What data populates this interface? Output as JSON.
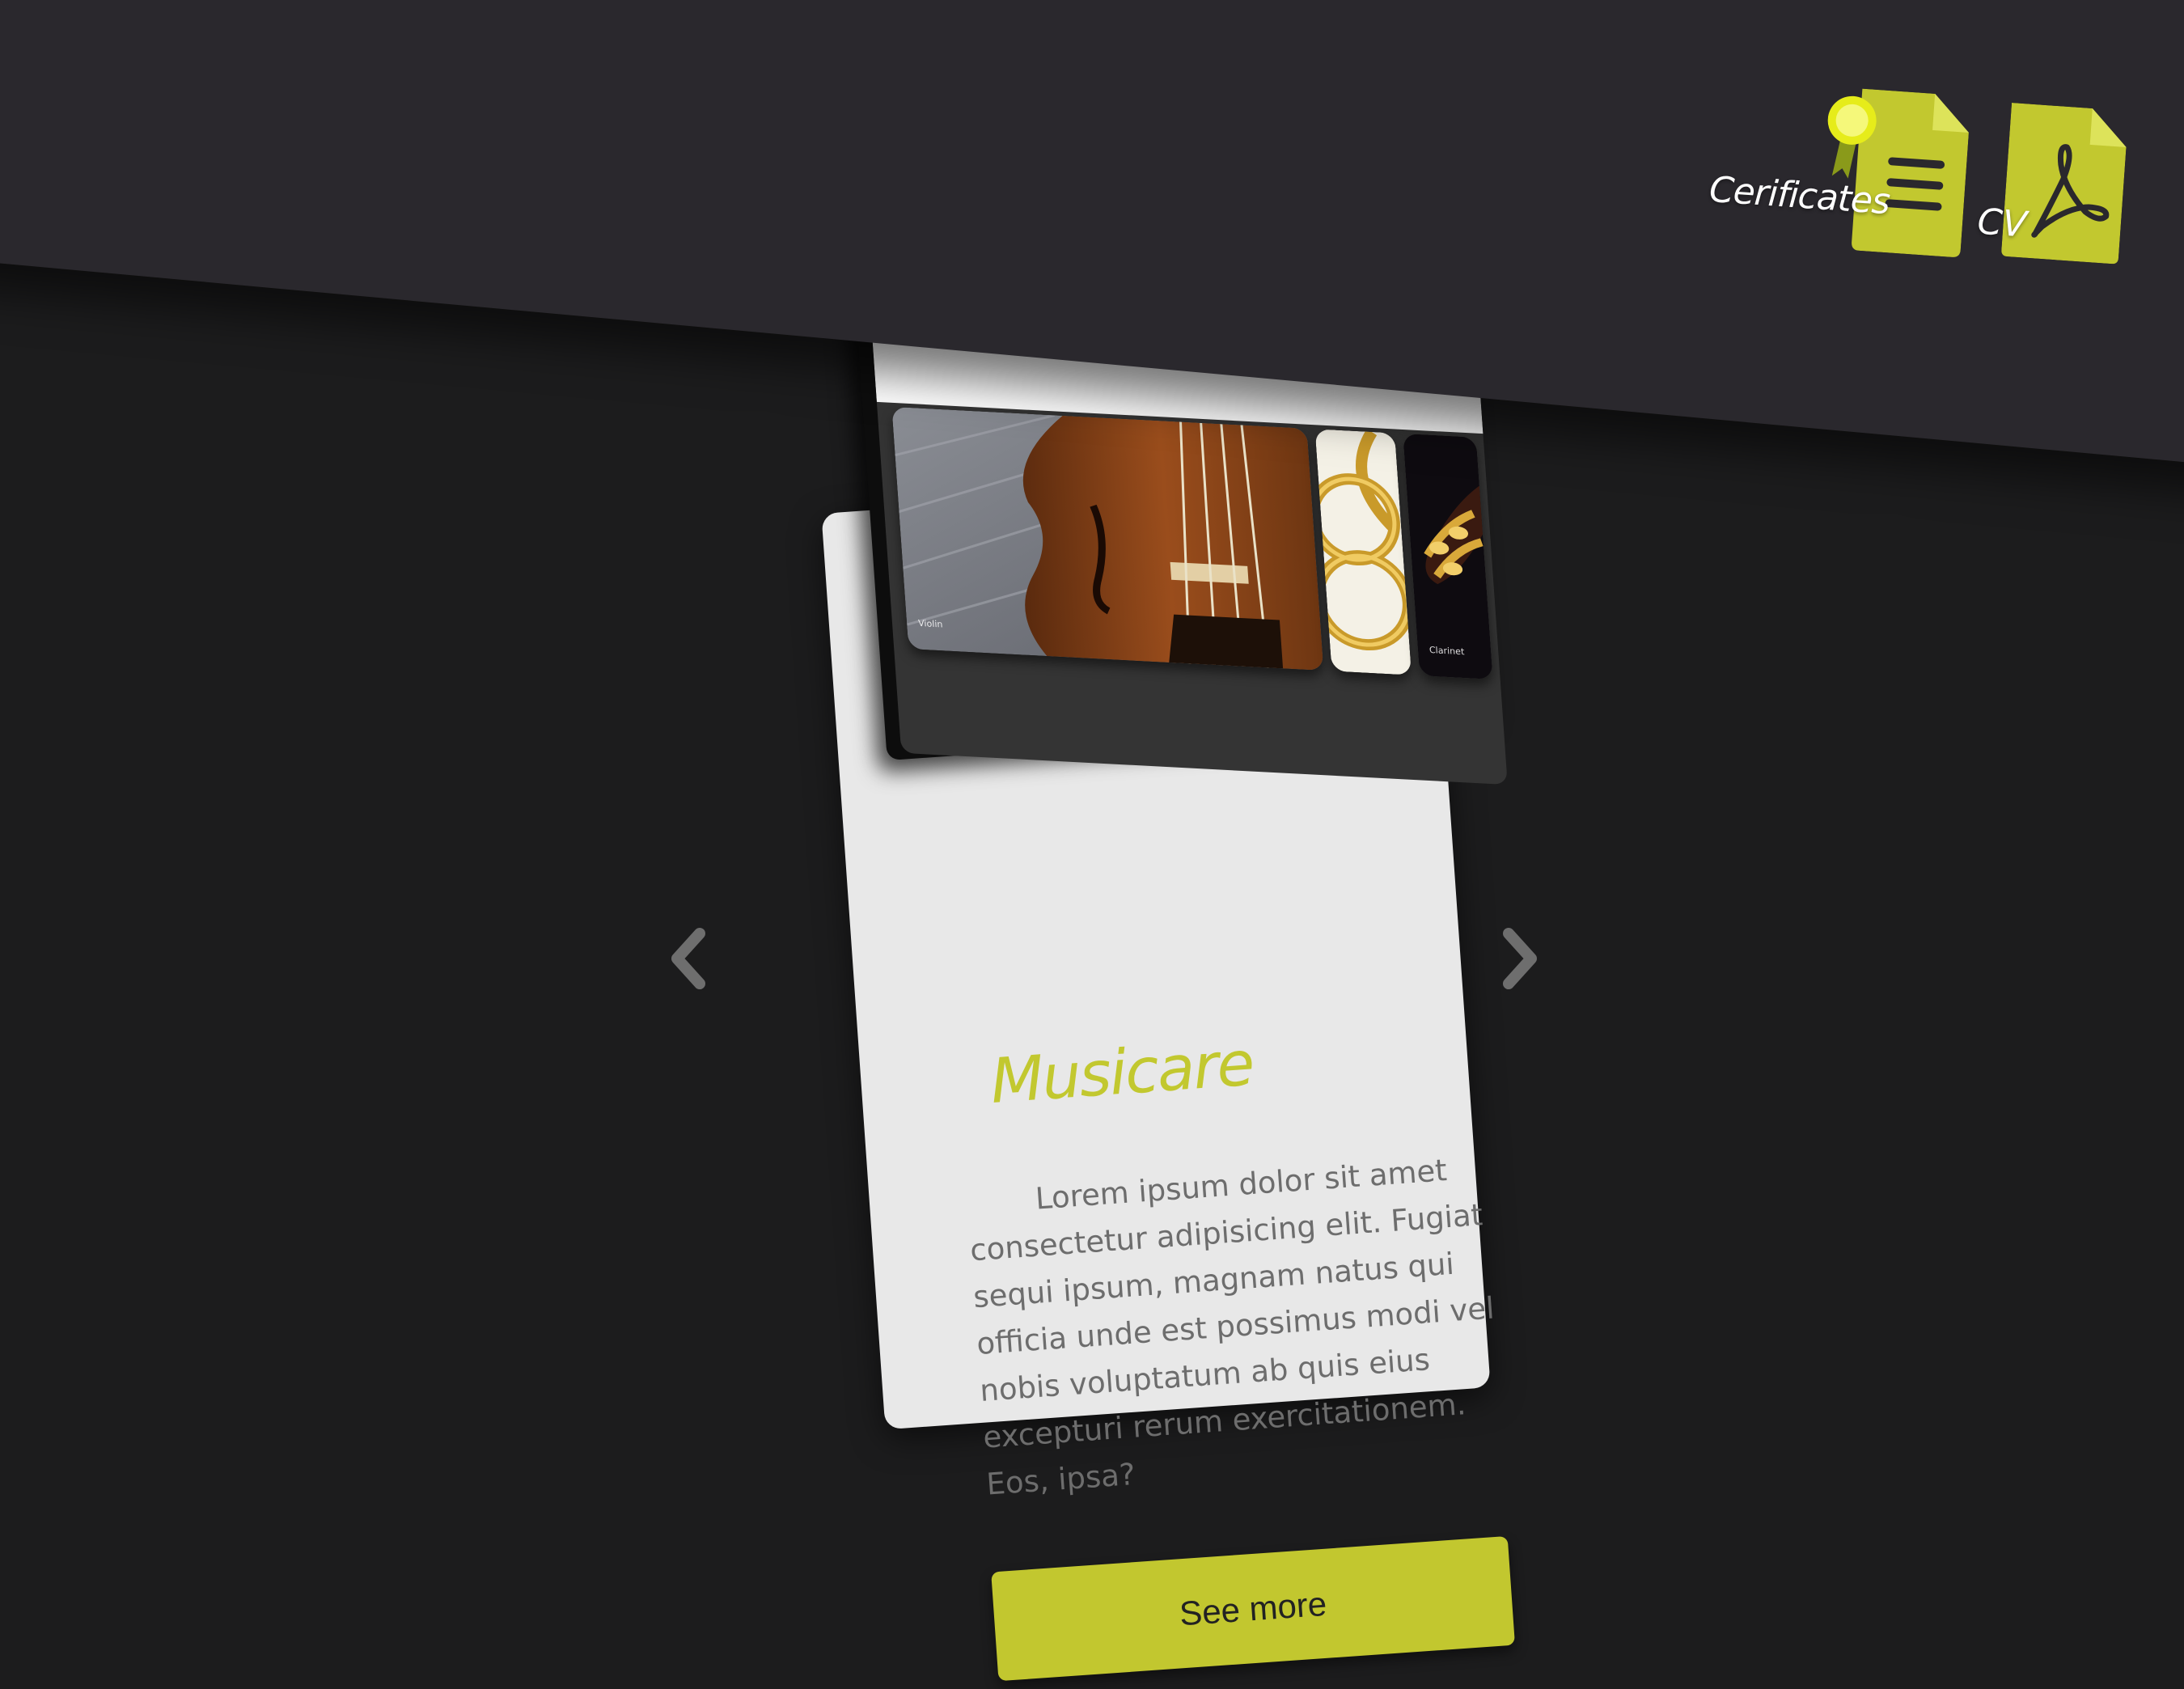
{
  "header": {
    "certificates_label": "Cerificates",
    "cv_label": "CV"
  },
  "card": {
    "title": "Musicare",
    "description": "Lorem ipsum dolor sit amet consectetur adipisicing elit. Fugiat sequi ipsum, magnam natus qui officia unde est possimus modi vel nobis voluptatum ab quis eius excepturi rerum exercitationem. Eos, ipsa?",
    "button_label": "See more",
    "gallery": {
      "thumbnails": [
        {
          "label": "Violin",
          "icon": "violin-photo"
        },
        {
          "label": "",
          "icon": "french-horn-photo"
        },
        {
          "label": "Clarinet",
          "icon": "clarinet-photo"
        }
      ]
    }
  },
  "navigation": {
    "prev_icon": "chevron-left-icon",
    "next_icon": "chevron-right-icon"
  },
  "colors": {
    "accent": "#c2c72f",
    "header_bg": "#2a282d",
    "page_bg": "#1c1c1d",
    "card_bg": "#e8e8e8",
    "gallery_bg": "#343434"
  }
}
